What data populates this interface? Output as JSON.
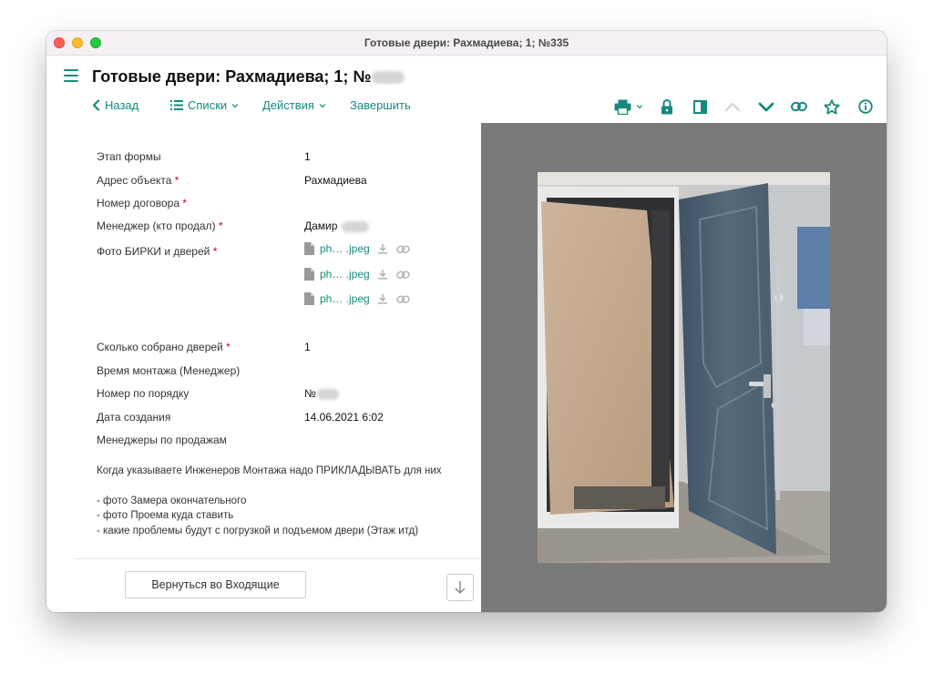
{
  "window": {
    "title": "Готовые двери: Рахмадиева; 1; №335"
  },
  "header": {
    "title": "Готовые двери: Рахмадиева; 1; №"
  },
  "toolbar": {
    "back_label": "Назад",
    "lists_label": "Списки",
    "actions_label": "Действия",
    "finish_label": "Завершить",
    "icons": [
      "print-icon",
      "lock-icon",
      "panel-icon",
      "chevron-up-icon",
      "chevron-down-icon",
      "link-icon",
      "star-icon",
      "info-icon"
    ]
  },
  "form": {
    "required_mark": "*",
    "fields": {
      "stage": {
        "label": "Этап формы",
        "value": "1"
      },
      "address": {
        "label": "Адрес объекта",
        "value": "Рахмадиева"
      },
      "contract": {
        "label": "Номер договора",
        "value": ""
      },
      "manager": {
        "label": "Менеджер (кто продал)",
        "value": "Дамир"
      },
      "photos": {
        "label": "Фото БИРКИ и дверей"
      },
      "count": {
        "label": "Сколько собрано дверей",
        "value": "1"
      },
      "install_time": {
        "label": "Время монтажа (Менеджер)",
        "value": ""
      },
      "seq_number": {
        "label": "Номер по порядку",
        "value": "№"
      },
      "created": {
        "label": "Дата создания",
        "value": "14.06.2021 6:02"
      },
      "sales_managers": {
        "label": "Менеджеры по продажам",
        "value": ""
      }
    },
    "files": [
      {
        "name": "ph… .jpeg"
      },
      {
        "name": "ph… .jpeg"
      },
      {
        "name": "ph… .jpeg"
      }
    ],
    "note": {
      "intro": "Когда указываете Инженеров Монтажа надо ПРИКЛАДЫВАТЬ для них",
      "items": [
        "- фото Замера окончательного",
        "- фото Проема куда ставить",
        "- какие проблемы будут с погрузкой и подъемом двери (Этаж итд)"
      ]
    }
  },
  "footer": {
    "return_label": "Вернуться во Входящие"
  },
  "colors": {
    "accent": "#168a7d",
    "required": "#d0021b",
    "preview_bg": "#7a7a7a",
    "door": "#4e6476"
  }
}
